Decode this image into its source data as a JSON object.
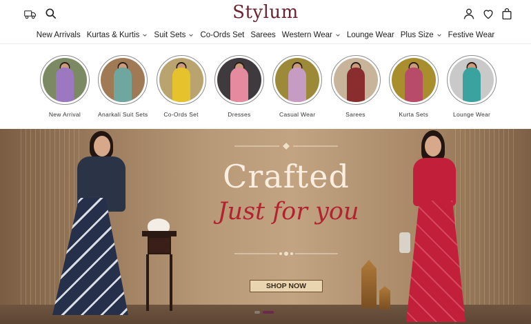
{
  "header": {
    "logo": "Stylum",
    "icons": [
      "shipping-icon",
      "search-icon",
      "account-icon",
      "wishlist-icon",
      "cart-icon"
    ]
  },
  "nav": {
    "items": [
      {
        "label": "New Arrivals",
        "dropdown": false
      },
      {
        "label": "Kurtas & Kurtis",
        "dropdown": true
      },
      {
        "label": "Suit Sets",
        "dropdown": true
      },
      {
        "label": "Co-Ords Set",
        "dropdown": false
      },
      {
        "label": "Sarees",
        "dropdown": false
      },
      {
        "label": "Western Wear",
        "dropdown": true
      },
      {
        "label": "Lounge Wear",
        "dropdown": false
      },
      {
        "label": "Plus Size",
        "dropdown": true
      },
      {
        "label": "Festive Wear",
        "dropdown": false
      }
    ]
  },
  "categories": [
    {
      "label": "New Arrival",
      "color": "#9b78c0",
      "bg": "#7c8a63"
    },
    {
      "label": "Anarkali Suit Sets",
      "color": "#6fa6a0",
      "bg": "#a07a55"
    },
    {
      "label": "Co-Ords Set",
      "color": "#e6c22c",
      "bg": "#b9a470"
    },
    {
      "label": "Dresses",
      "color": "#e68aa0",
      "bg": "#3f3a3e"
    },
    {
      "label": "Casual Wear",
      "color": "#c79cc4",
      "bg": "#9c8a39"
    },
    {
      "label": "Sarees",
      "color": "#8a2d2e",
      "bg": "#c7b49a"
    },
    {
      "label": "Kurta Sets",
      "color": "#b84a6a",
      "bg": "#a98e2e"
    },
    {
      "label": "Lounge Wear",
      "color": "#3aa3a0",
      "bg": "#c9c9c9"
    }
  ],
  "banner": {
    "headline": "Crafted",
    "tagline": "Just for you",
    "cta": "SHOP NOW",
    "slides": 2,
    "active_slide": 2
  },
  "colors": {
    "brand": "#6b2430",
    "tagline": "#b2232f",
    "cta_bg": "#e9d5b0"
  }
}
